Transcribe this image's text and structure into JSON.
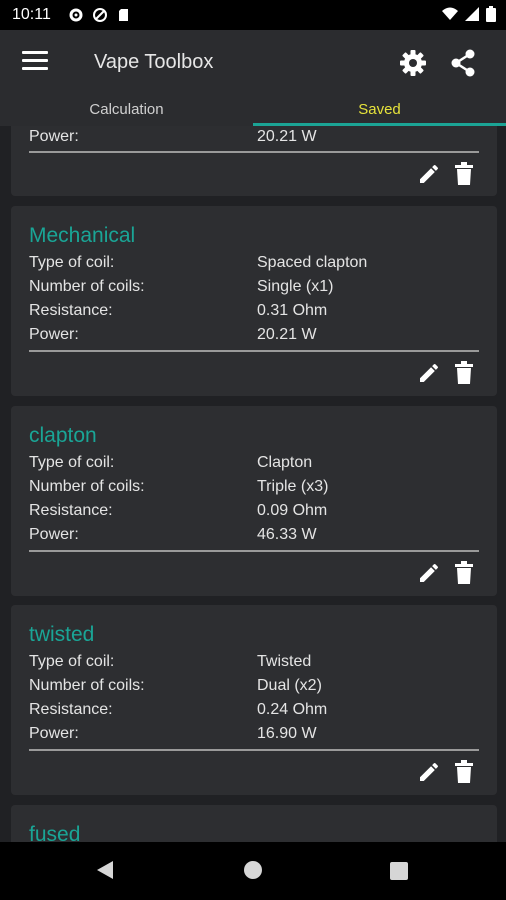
{
  "status": {
    "time": "10:11"
  },
  "app": {
    "title": "Vape Toolbox"
  },
  "tabs": [
    {
      "label": "Calculation"
    },
    {
      "label": "Saved"
    }
  ],
  "colors": {
    "accent": "#1ba495",
    "selected_tab": "#e5e23b",
    "card": "#2d2e31"
  },
  "partial_top_card": {
    "power_label": "Power:",
    "power_value": "20.21 W"
  },
  "labels": {
    "type": "Type of coil:",
    "number": "Number of coils:",
    "resistance": "Resistance:",
    "power": "Power:"
  },
  "cards": [
    {
      "name": "Mechanical",
      "type": "Spaced clapton",
      "number": "Single (x1)",
      "resistance": "0.31 Ohm",
      "power": "20.21 W"
    },
    {
      "name": "clapton",
      "type": "Clapton",
      "number": "Triple (x3)",
      "resistance": "0.09 Ohm",
      "power": "46.33 W"
    },
    {
      "name": "twisted",
      "type": "Twisted",
      "number": "Dual (x2)",
      "resistance": "0.24 Ohm",
      "power": "16.90 W"
    }
  ],
  "partial_bottom_card": {
    "name": "fused"
  },
  "icons": {
    "menu": "menu-icon",
    "settings": "gear-icon",
    "share": "share-icon",
    "edit": "pencil-icon",
    "delete": "trash-icon"
  }
}
